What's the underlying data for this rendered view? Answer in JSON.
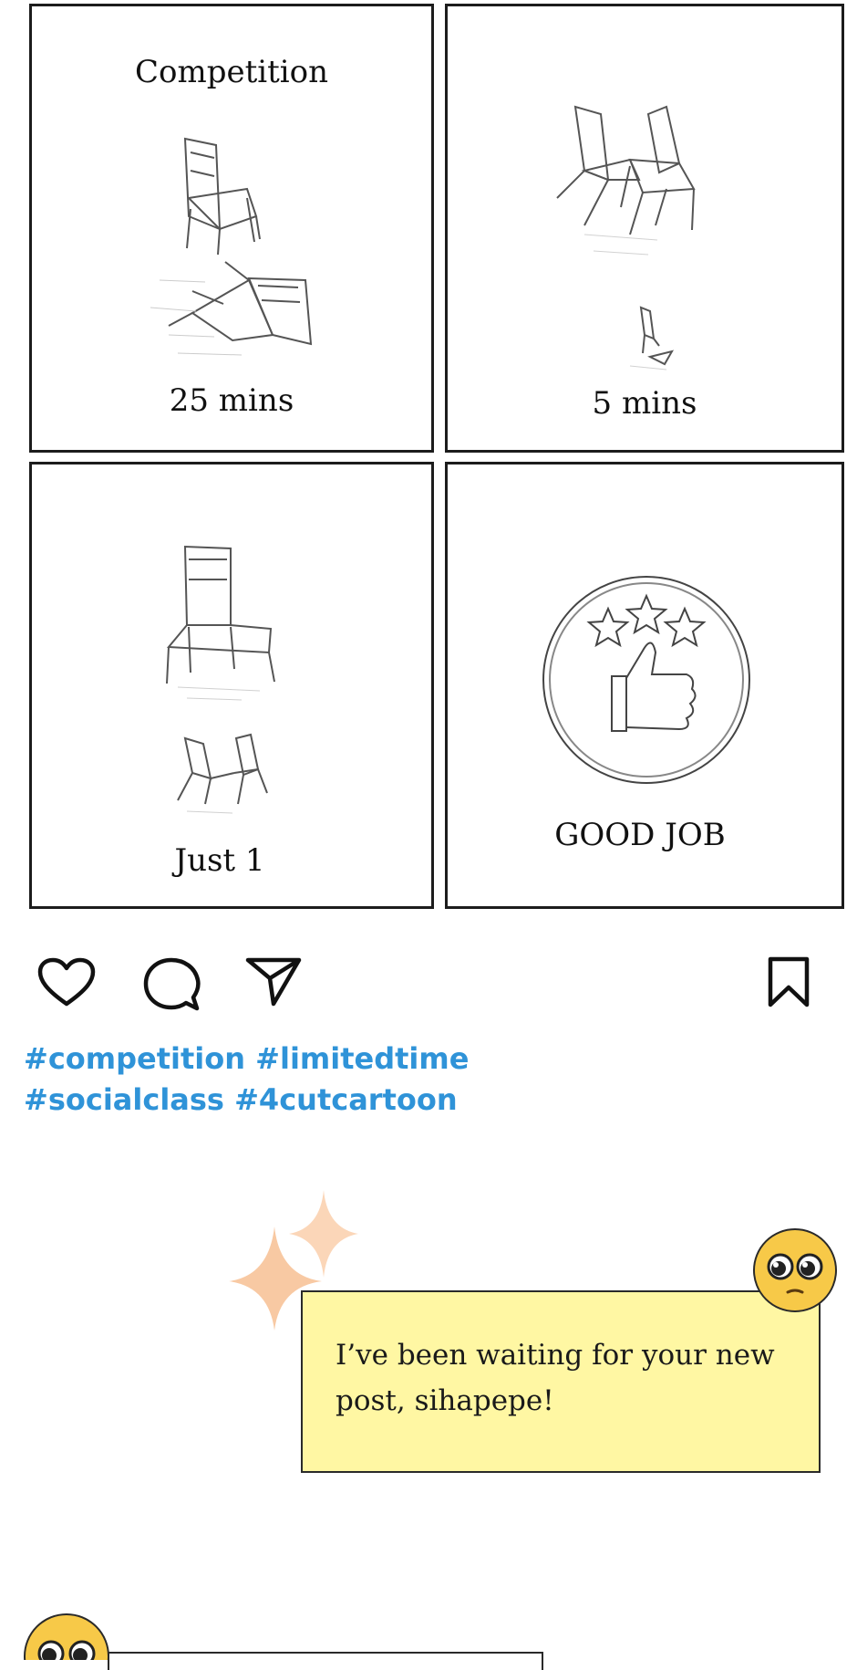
{
  "panels": [
    {
      "caption": "Competition",
      "caption2": "25 mins"
    },
    {
      "caption": "5 mins"
    },
    {
      "caption": "Just 1"
    },
    {
      "caption": "GOOD JOB"
    }
  ],
  "actions": {
    "like_icon": "heart-icon",
    "comment_icon": "speech-bubble-icon",
    "share_icon": "paper-plane-icon",
    "save_icon": "bookmark-icon"
  },
  "hashtags": {
    "line1": "#competition #limitedtime",
    "line2": "#socialclass #4cutcartoon"
  },
  "comment": {
    "text": "I’ve been waiting for your new post, sihapepe!",
    "background": "#fff7a3"
  },
  "colors": {
    "hashtag": "#2f93d8",
    "sparkle": "#f8c9a3",
    "emoji": "#f7c948"
  }
}
